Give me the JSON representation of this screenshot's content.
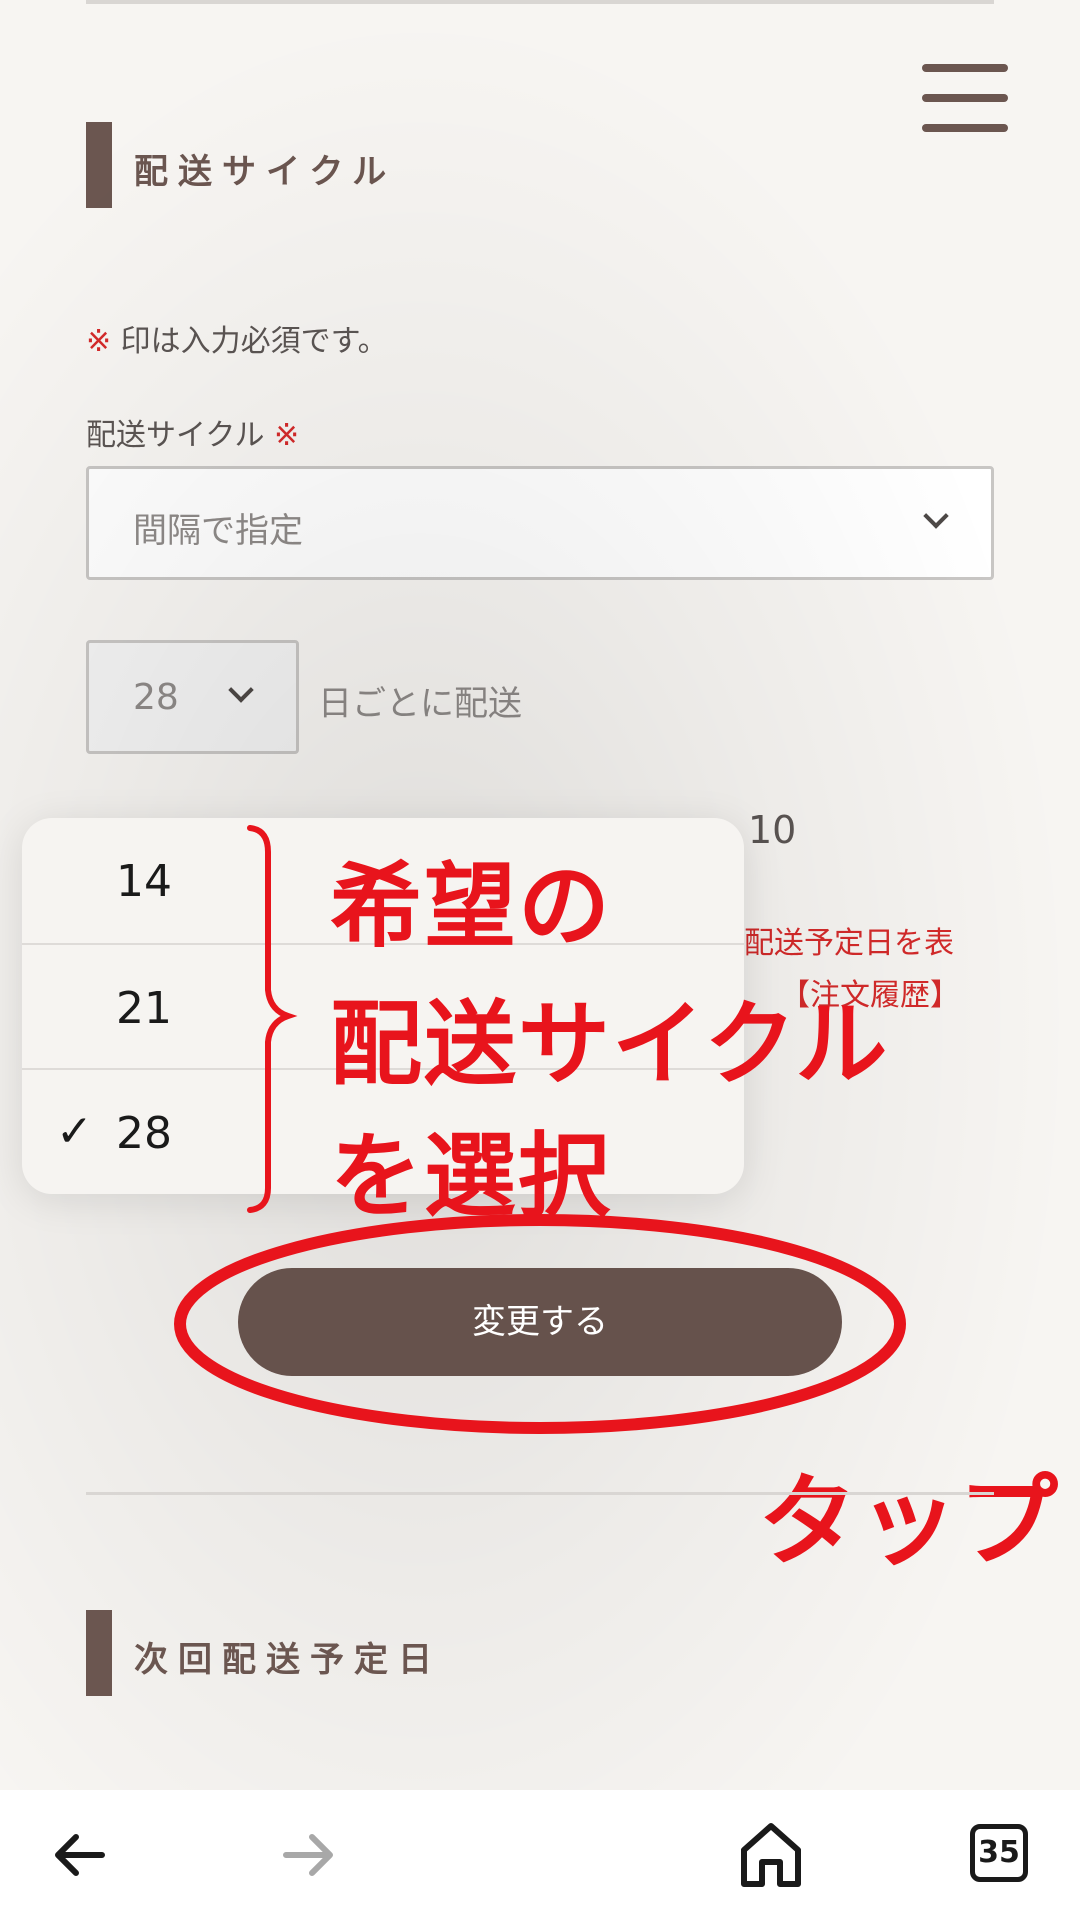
{
  "section_delivery_cycle": {
    "title": "配送サイクル"
  },
  "required_note": {
    "mark": "※",
    "text": " 印は入力必須です。"
  },
  "cycle_field": {
    "label": "配送サイクル ",
    "required_mark": "※",
    "selected_value": "間隔で指定"
  },
  "days_field": {
    "selected_value": "28",
    "suffix": "日ごとに配送"
  },
  "obscured_text": {
    "line1_tail": "10",
    "notice_line1_tail": "配送予定日を表",
    "notice_line2_tail": "【注文履歴】"
  },
  "picker": {
    "options": [
      "14",
      "21",
      "28"
    ],
    "selected": "28",
    "check_mark": "✓"
  },
  "submit_button": {
    "label": "変更する"
  },
  "annotations": {
    "line1": "希望の",
    "line2": "配送サイクル",
    "line3": "を選択",
    "tap": "タップ",
    "color": "#e8141c"
  },
  "section_next_delivery": {
    "title": "次回配送予定日"
  },
  "browser_bar": {
    "back_icon": "arrow-left-icon",
    "forward_icon": "arrow-right-icon",
    "home_icon": "home-icon",
    "tab_count": "35"
  },
  "colors": {
    "brand_brown": "#6b5650",
    "button_brown": "#66524c",
    "required_red": "#d42a2a",
    "background": "#f7f5f2"
  }
}
